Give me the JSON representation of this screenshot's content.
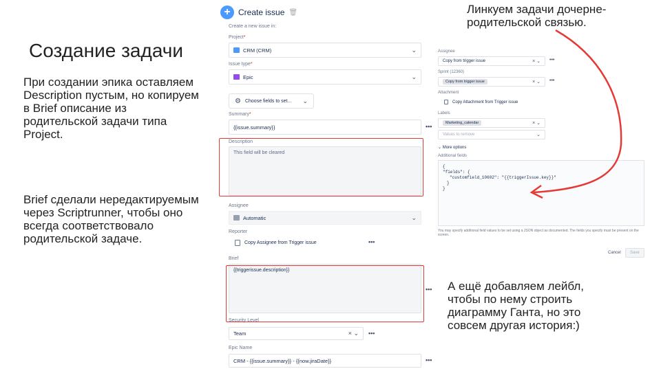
{
  "slide": {
    "title": "Создание задачи",
    "note_epic": "При создании эпика оставляем Description пустым, но копируем в Brief описание из родительской задачи типа Project.",
    "note_brief": "Brief сделали нередактируемым через Scriptrunner, чтобы оно всегда соответствовало родительской задаче.",
    "note_label": "А ещё добавляем лейбл, чтобы по нему строить диаграмму Ганта, но это совсем другая история:)",
    "note_link": "Линкуем задачи дочерне-родительской связью."
  },
  "form": {
    "title": "Create issue",
    "create_in": "Create a new issue in:",
    "project_label": "Project",
    "project_value": "CRM (CRM)",
    "issue_type_label": "Issue type",
    "issue_type_value": "Epic",
    "choose_fields": "Choose fields to set...",
    "summary_label": "Summary",
    "summary_value": "{{issue.summary}}",
    "description_label": "Description",
    "description_placeholder": "This field will be cleared",
    "assignee_label": "Assignee",
    "assignee_value": "Automatic",
    "reporter_label": "Reporter",
    "reporter_value": "Copy Assignee from Trigger issue",
    "brief_label": "Brief",
    "brief_value": "{{triggerissue.description}}",
    "security_label": "Security Level",
    "security_value": "Team",
    "epic_name_label": "Epic Name",
    "epic_name_value": "CRM - {{issue.summary}} - {{now.jiraDate}}",
    "more_icon": "•••"
  },
  "panel": {
    "assignee_label": "Assignee",
    "assignee_value": "Copy from trigger issue",
    "sprint_label": "Sprint (12360)",
    "sprint_value": "Copy from trigger issue",
    "attachment_label": "Attachment",
    "attachment_value": "Copy Attachment from Trigger issue",
    "labels_label": "Labels",
    "labels_tag": "Marketing_calendar",
    "labels_remove": "Values to remove",
    "more_options": "More options",
    "additional_label": "Additional fields",
    "json_line1": "{",
    "json_line2": "\"fields\": {",
    "json_line3": "\"customfield_10602\": \"{{triggerIssue.key}}\"",
    "json_line4": "}",
    "json_line5": "}",
    "help_text": "You may specify additional field values to be set using a JSON object as documented. The fields you specify must be present on the screen.",
    "cancel": "Cancel",
    "save": "Save"
  },
  "colors": {
    "highlight": "#e53935",
    "accent": "#4c9aff"
  }
}
